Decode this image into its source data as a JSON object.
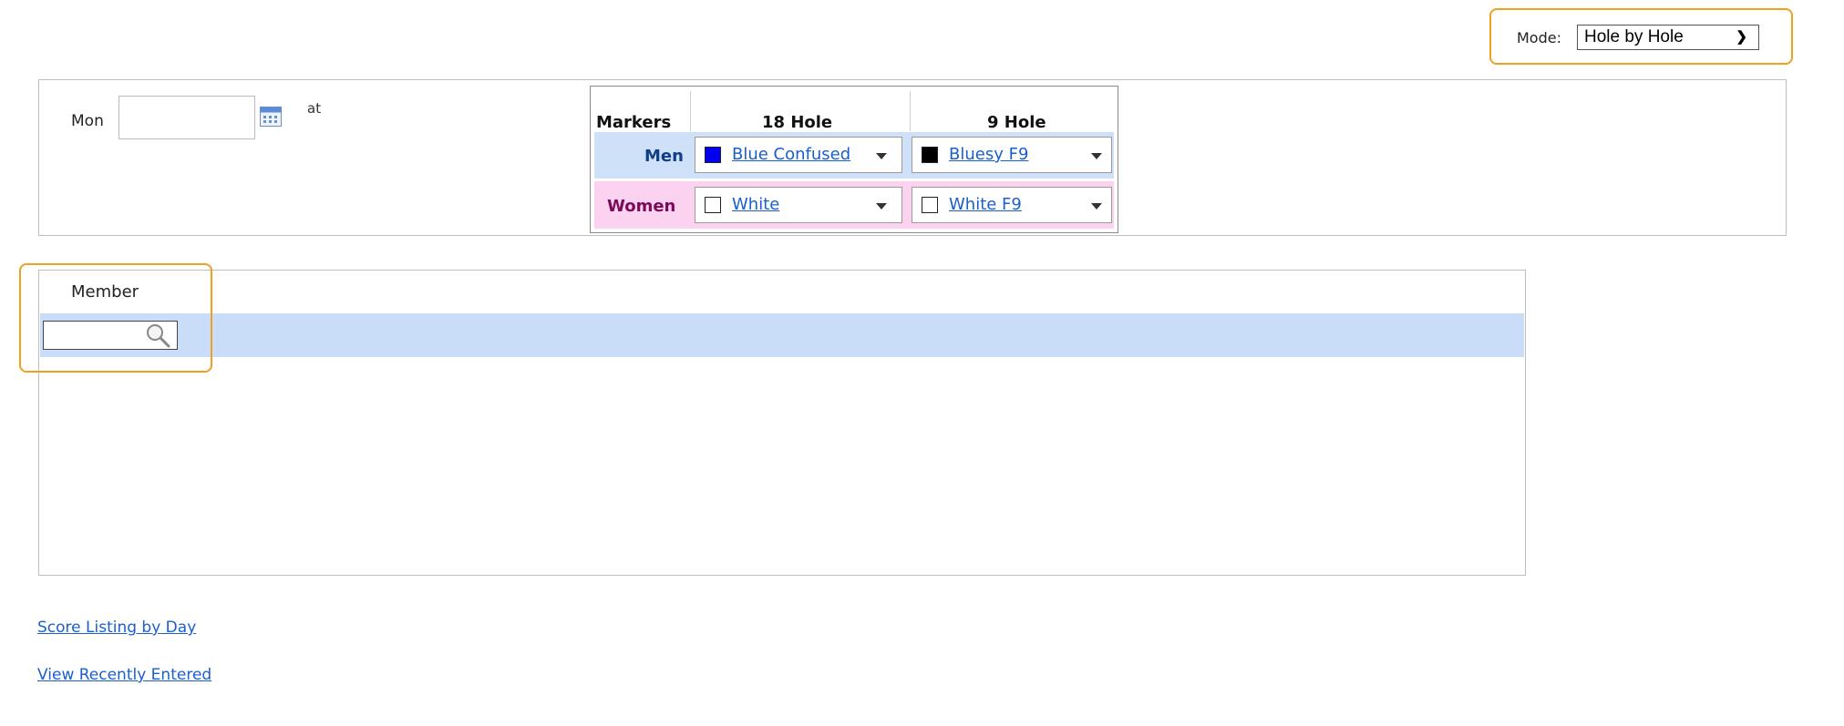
{
  "mode": {
    "label": "Mode:",
    "selected": "Hole by Hole"
  },
  "date": {
    "day": "Mon",
    "value": "",
    "at": "at"
  },
  "markers": {
    "title": "Markers",
    "col18": "18 Hole",
    "col9": "9 Hole",
    "rows": [
      {
        "label": "Men",
        "label_color": "#0f3d8a",
        "bg": "#cfe0f9",
        "m18": {
          "text": "Blue Confused",
          "swatch": "#0000ee"
        },
        "m9": {
          "text": "Bluesy F9",
          "swatch": "#000000"
        }
      },
      {
        "label": "Women",
        "label_color": "#7a0a5a",
        "bg": "#fbd2ef",
        "m18": {
          "text": "White",
          "swatch": "#ffffff"
        },
        "m9": {
          "text": "White F9",
          "swatch": "#ffffff"
        }
      }
    ]
  },
  "member": {
    "label": "Member",
    "search_value": ""
  },
  "links": {
    "score_listing": "Score Listing by Day",
    "recently_entered": "View Recently Entered"
  },
  "colors": {
    "accent_outline": "#f0a020",
    "link": "#1a5fcc",
    "row_highlight": "#c9dcf8"
  }
}
